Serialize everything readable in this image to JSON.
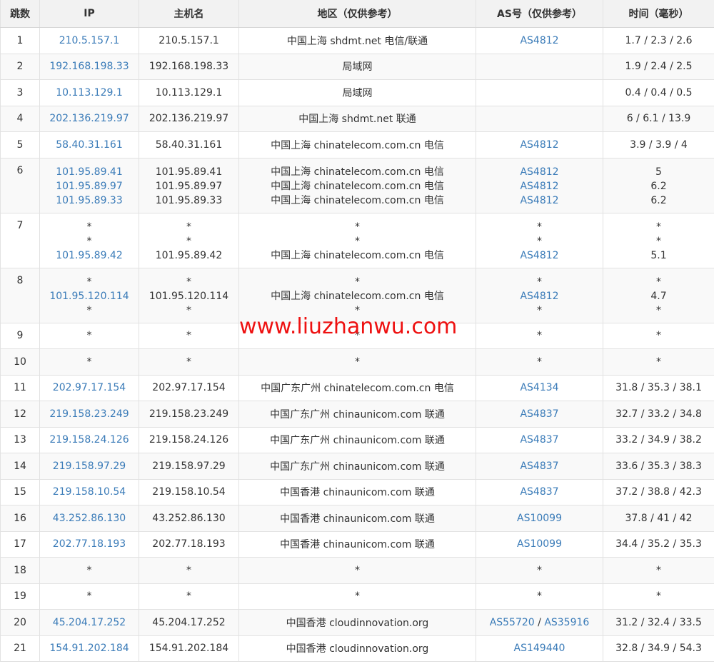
{
  "headers": [
    "跳数",
    "IP",
    "主机名",
    "地区（仅供参考）",
    "AS号（仅供参考）",
    "时间（毫秒）"
  ],
  "watermark": "www.liuzhanwu.com",
  "rows": [
    {
      "hop": "1",
      "lines": [
        {
          "ip": "210.5.157.1",
          "host": "210.5.157.1",
          "region": "中国上海 shdmt.net 电信/联通",
          "as": [
            "AS4812"
          ],
          "time": "1.7 / 2.3 / 2.6"
        }
      ]
    },
    {
      "hop": "2",
      "lines": [
        {
          "ip": "192.168.198.33",
          "host": "192.168.198.33",
          "region": "局域网",
          "as": [],
          "time": "1.9 / 2.4 / 2.5"
        }
      ]
    },
    {
      "hop": "3",
      "lines": [
        {
          "ip": "10.113.129.1",
          "host": "10.113.129.1",
          "region": "局域网",
          "as": [],
          "time": "0.4 / 0.4 / 0.5"
        }
      ]
    },
    {
      "hop": "4",
      "lines": [
        {
          "ip": "202.136.219.97",
          "host": "202.136.219.97",
          "region": "中国上海 shdmt.net 联通",
          "as": [],
          "time": "6 / 6.1 / 13.9"
        }
      ]
    },
    {
      "hop": "5",
      "lines": [
        {
          "ip": "58.40.31.161",
          "host": "58.40.31.161",
          "region": "中国上海 chinatelecom.com.cn 电信",
          "as": [
            "AS4812"
          ],
          "time": "3.9 / 3.9 / 4"
        }
      ]
    },
    {
      "hop": "6",
      "lines": [
        {
          "ip": "101.95.89.41",
          "host": "101.95.89.41",
          "region": "中国上海 chinatelecom.com.cn 电信",
          "as": [
            "AS4812"
          ],
          "time": "5"
        },
        {
          "ip": "101.95.89.97",
          "host": "101.95.89.97",
          "region": "中国上海 chinatelecom.com.cn 电信",
          "as": [
            "AS4812"
          ],
          "time": "6.2"
        },
        {
          "ip": "101.95.89.33",
          "host": "101.95.89.33",
          "region": "中国上海 chinatelecom.com.cn 电信",
          "as": [
            "AS4812"
          ],
          "time": "6.2"
        }
      ]
    },
    {
      "hop": "7",
      "lines": [
        {
          "ip": "*",
          "host": "*",
          "region": "*",
          "as": [
            "*"
          ],
          "time": "*"
        },
        {
          "ip": "*",
          "host": "*",
          "region": "*",
          "as": [
            "*"
          ],
          "time": "*"
        },
        {
          "ip": "101.95.89.42",
          "host": "101.95.89.42",
          "region": "中国上海 chinatelecom.com.cn 电信",
          "as": [
            "AS4812"
          ],
          "time": "5.1"
        }
      ]
    },
    {
      "hop": "8",
      "lines": [
        {
          "ip": "*",
          "host": "*",
          "region": "*",
          "as": [
            "*"
          ],
          "time": "*"
        },
        {
          "ip": "101.95.120.114",
          "host": "101.95.120.114",
          "region": "中国上海 chinatelecom.com.cn 电信",
          "as": [
            "AS4812"
          ],
          "time": "4.7"
        },
        {
          "ip": "*",
          "host": "*",
          "region": "*",
          "as": [
            "*"
          ],
          "time": "*"
        }
      ]
    },
    {
      "hop": "9",
      "lines": [
        {
          "ip": "*",
          "host": "*",
          "region": "*",
          "as": [
            "*"
          ],
          "time": "*"
        }
      ]
    },
    {
      "hop": "10",
      "lines": [
        {
          "ip": "*",
          "host": "*",
          "region": "*",
          "as": [
            "*"
          ],
          "time": "*"
        }
      ]
    },
    {
      "hop": "11",
      "lines": [
        {
          "ip": "202.97.17.154",
          "host": "202.97.17.154",
          "region": "中国广东广州 chinatelecom.com.cn 电信",
          "as": [
            "AS4134"
          ],
          "time": "31.8 / 35.3 / 38.1"
        }
      ]
    },
    {
      "hop": "12",
      "lines": [
        {
          "ip": "219.158.23.249",
          "host": "219.158.23.249",
          "region": "中国广东广州 chinaunicom.com 联通",
          "as": [
            "AS4837"
          ],
          "time": "32.7 / 33.2 / 34.8"
        }
      ]
    },
    {
      "hop": "13",
      "lines": [
        {
          "ip": "219.158.24.126",
          "host": "219.158.24.126",
          "region": "中国广东广州 chinaunicom.com 联通",
          "as": [
            "AS4837"
          ],
          "time": "33.2 / 34.9 / 38.2"
        }
      ]
    },
    {
      "hop": "14",
      "lines": [
        {
          "ip": "219.158.97.29",
          "host": "219.158.97.29",
          "region": "中国广东广州 chinaunicom.com 联通",
          "as": [
            "AS4837"
          ],
          "time": "33.6 / 35.3 / 38.3"
        }
      ]
    },
    {
      "hop": "15",
      "lines": [
        {
          "ip": "219.158.10.54",
          "host": "219.158.10.54",
          "region": "中国香港 chinaunicom.com 联通",
          "as": [
            "AS4837"
          ],
          "time": "37.2 / 38.8 / 42.3"
        }
      ]
    },
    {
      "hop": "16",
      "lines": [
        {
          "ip": "43.252.86.130",
          "host": "43.252.86.130",
          "region": "中国香港 chinaunicom.com 联通",
          "as": [
            "AS10099"
          ],
          "time": "37.8 / 41 / 42"
        }
      ]
    },
    {
      "hop": "17",
      "lines": [
        {
          "ip": "202.77.18.193",
          "host": "202.77.18.193",
          "region": "中国香港 chinaunicom.com 联通",
          "as": [
            "AS10099"
          ],
          "time": "34.4 / 35.2 / 35.3"
        }
      ]
    },
    {
      "hop": "18",
      "lines": [
        {
          "ip": "*",
          "host": "*",
          "region": "*",
          "as": [
            "*"
          ],
          "time": "*"
        }
      ]
    },
    {
      "hop": "19",
      "lines": [
        {
          "ip": "*",
          "host": "*",
          "region": "*",
          "as": [
            "*"
          ],
          "time": "*"
        }
      ]
    },
    {
      "hop": "20",
      "lines": [
        {
          "ip": "45.204.17.252",
          "host": "45.204.17.252",
          "region": "中国香港 cloudinnovation.org",
          "as": [
            "AS55720",
            "AS35916"
          ],
          "time": "31.2 / 32.4 / 33.5"
        }
      ]
    },
    {
      "hop": "21",
      "lines": [
        {
          "ip": "154.91.202.184",
          "host": "154.91.202.184",
          "region": "中国香港 cloudinnovation.org",
          "as": [
            "AS149440"
          ],
          "time": "32.8 / 34.9 / 54.3"
        }
      ]
    }
  ]
}
